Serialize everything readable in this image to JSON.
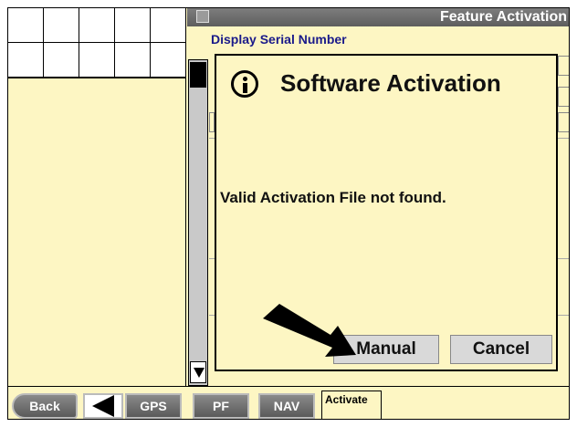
{
  "window": {
    "title": "Feature Activation",
    "icon": "window-icon"
  },
  "section": {
    "heading": "Display Serial Number"
  },
  "dialog": {
    "icon": "info-icon",
    "title": "Software Activation",
    "message": "Valid Activation File not found.",
    "buttons": {
      "manual": "Manual",
      "cancel": "Cancel"
    }
  },
  "bottom_bar": {
    "back": "Back",
    "gps": "GPS",
    "pf": "PF",
    "nav": "NAV",
    "activate_tab": "Activate"
  },
  "colors": {
    "background": "#fdf6c3",
    "title_bar": "#6e6e6e",
    "heading": "#1a1a8a",
    "button": "#d9d9d9"
  }
}
